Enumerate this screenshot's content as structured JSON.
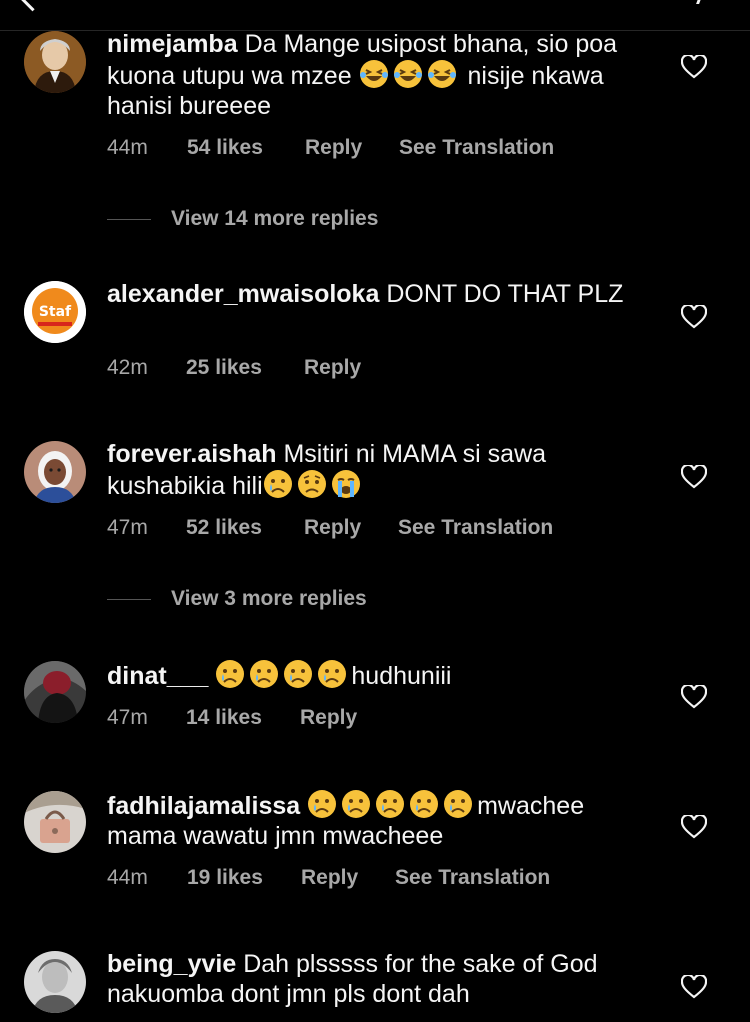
{
  "comments": [
    {
      "username": "nimejamba",
      "text_a": "Da Mange usipost bhana, sio poa kuona utupu wa mzee",
      "text_b": "nisije nkawa hanisi bureeee",
      "time": "44m",
      "likes": "54 likes",
      "reply": "Reply",
      "translate": "See Translation"
    },
    {
      "username": "alexander_mwaisoloka",
      "text": "DONT DO THAT PLZ",
      "time": "42m",
      "likes": "25 likes",
      "reply": "Reply"
    },
    {
      "username": "forever.aishah",
      "text_a": "Msitiri ni MAMA si sawa kushabikia hili",
      "time": "47m",
      "likes": "52 likes",
      "reply": "Reply",
      "translate": "See Translation"
    },
    {
      "username": "dinat___",
      "text_b": "hudhuniii",
      "time": "47m",
      "likes": "14 likes",
      "reply": "Reply"
    },
    {
      "username": "fadhilajamalissa",
      "text_b": "mwachee mama wawatu jmn mwacheee",
      "time": "44m",
      "likes": "19 likes",
      "reply": "Reply",
      "translate": "See Translation"
    },
    {
      "username": "being_yvie",
      "text": "Dah plsssss for the sake of God nakuomba dont jmn pls dont dah"
    }
  ],
  "view_replies": [
    "View 14 more replies",
    "View 3 more replies"
  ],
  "avatar_logo_text": "Staf",
  "colors": {
    "background": "#000000",
    "text": "#f5f5f5",
    "muted": "#a8a8a8",
    "emoji": "#f7c23b"
  },
  "icons": [
    "back-arrow-icon",
    "more-icon",
    "heart-icon",
    "laughing-emoji",
    "crying-emoji",
    "sad-emoji",
    "sobbing-emoji"
  ]
}
